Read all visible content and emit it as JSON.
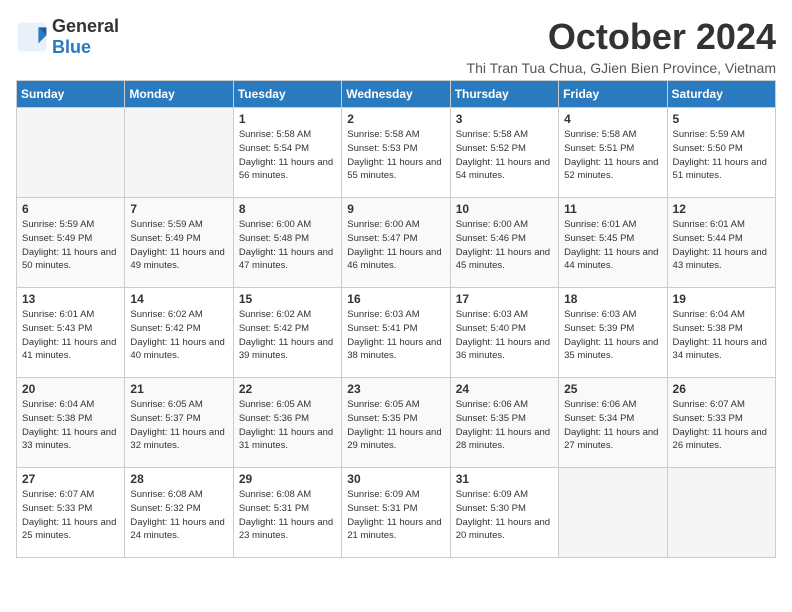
{
  "logo": {
    "line1": "General",
    "line2": "Blue"
  },
  "title": "October 2024",
  "subtitle": "Thi Tran Tua Chua, GJien Bien Province, Vietnam",
  "headers": [
    "Sunday",
    "Monday",
    "Tuesday",
    "Wednesday",
    "Thursday",
    "Friday",
    "Saturday"
  ],
  "weeks": [
    [
      {
        "day": null
      },
      {
        "day": null
      },
      {
        "day": "1",
        "sunrise": "5:58 AM",
        "sunset": "5:54 PM",
        "daylight": "11 hours and 56 minutes."
      },
      {
        "day": "2",
        "sunrise": "5:58 AM",
        "sunset": "5:53 PM",
        "daylight": "11 hours and 55 minutes."
      },
      {
        "day": "3",
        "sunrise": "5:58 AM",
        "sunset": "5:52 PM",
        "daylight": "11 hours and 54 minutes."
      },
      {
        "day": "4",
        "sunrise": "5:58 AM",
        "sunset": "5:51 PM",
        "daylight": "11 hours and 52 minutes."
      },
      {
        "day": "5",
        "sunrise": "5:59 AM",
        "sunset": "5:50 PM",
        "daylight": "11 hours and 51 minutes."
      }
    ],
    [
      {
        "day": "6",
        "sunrise": "5:59 AM",
        "sunset": "5:49 PM",
        "daylight": "11 hours and 50 minutes."
      },
      {
        "day": "7",
        "sunrise": "5:59 AM",
        "sunset": "5:49 PM",
        "daylight": "11 hours and 49 minutes."
      },
      {
        "day": "8",
        "sunrise": "6:00 AM",
        "sunset": "5:48 PM",
        "daylight": "11 hours and 47 minutes."
      },
      {
        "day": "9",
        "sunrise": "6:00 AM",
        "sunset": "5:47 PM",
        "daylight": "11 hours and 46 minutes."
      },
      {
        "day": "10",
        "sunrise": "6:00 AM",
        "sunset": "5:46 PM",
        "daylight": "11 hours and 45 minutes."
      },
      {
        "day": "11",
        "sunrise": "6:01 AM",
        "sunset": "5:45 PM",
        "daylight": "11 hours and 44 minutes."
      },
      {
        "day": "12",
        "sunrise": "6:01 AM",
        "sunset": "5:44 PM",
        "daylight": "11 hours and 43 minutes."
      }
    ],
    [
      {
        "day": "13",
        "sunrise": "6:01 AM",
        "sunset": "5:43 PM",
        "daylight": "11 hours and 41 minutes."
      },
      {
        "day": "14",
        "sunrise": "6:02 AM",
        "sunset": "5:42 PM",
        "daylight": "11 hours and 40 minutes."
      },
      {
        "day": "15",
        "sunrise": "6:02 AM",
        "sunset": "5:42 PM",
        "daylight": "11 hours and 39 minutes."
      },
      {
        "day": "16",
        "sunrise": "6:03 AM",
        "sunset": "5:41 PM",
        "daylight": "11 hours and 38 minutes."
      },
      {
        "day": "17",
        "sunrise": "6:03 AM",
        "sunset": "5:40 PM",
        "daylight": "11 hours and 36 minutes."
      },
      {
        "day": "18",
        "sunrise": "6:03 AM",
        "sunset": "5:39 PM",
        "daylight": "11 hours and 35 minutes."
      },
      {
        "day": "19",
        "sunrise": "6:04 AM",
        "sunset": "5:38 PM",
        "daylight": "11 hours and 34 minutes."
      }
    ],
    [
      {
        "day": "20",
        "sunrise": "6:04 AM",
        "sunset": "5:38 PM",
        "daylight": "11 hours and 33 minutes."
      },
      {
        "day": "21",
        "sunrise": "6:05 AM",
        "sunset": "5:37 PM",
        "daylight": "11 hours and 32 minutes."
      },
      {
        "day": "22",
        "sunrise": "6:05 AM",
        "sunset": "5:36 PM",
        "daylight": "11 hours and 31 minutes."
      },
      {
        "day": "23",
        "sunrise": "6:05 AM",
        "sunset": "5:35 PM",
        "daylight": "11 hours and 29 minutes."
      },
      {
        "day": "24",
        "sunrise": "6:06 AM",
        "sunset": "5:35 PM",
        "daylight": "11 hours and 28 minutes."
      },
      {
        "day": "25",
        "sunrise": "6:06 AM",
        "sunset": "5:34 PM",
        "daylight": "11 hours and 27 minutes."
      },
      {
        "day": "26",
        "sunrise": "6:07 AM",
        "sunset": "5:33 PM",
        "daylight": "11 hours and 26 minutes."
      }
    ],
    [
      {
        "day": "27",
        "sunrise": "6:07 AM",
        "sunset": "5:33 PM",
        "daylight": "11 hours and 25 minutes."
      },
      {
        "day": "28",
        "sunrise": "6:08 AM",
        "sunset": "5:32 PM",
        "daylight": "11 hours and 24 minutes."
      },
      {
        "day": "29",
        "sunrise": "6:08 AM",
        "sunset": "5:31 PM",
        "daylight": "11 hours and 23 minutes."
      },
      {
        "day": "30",
        "sunrise": "6:09 AM",
        "sunset": "5:31 PM",
        "daylight": "11 hours and 21 minutes."
      },
      {
        "day": "31",
        "sunrise": "6:09 AM",
        "sunset": "5:30 PM",
        "daylight": "11 hours and 20 minutes."
      },
      {
        "day": null
      },
      {
        "day": null
      }
    ]
  ]
}
